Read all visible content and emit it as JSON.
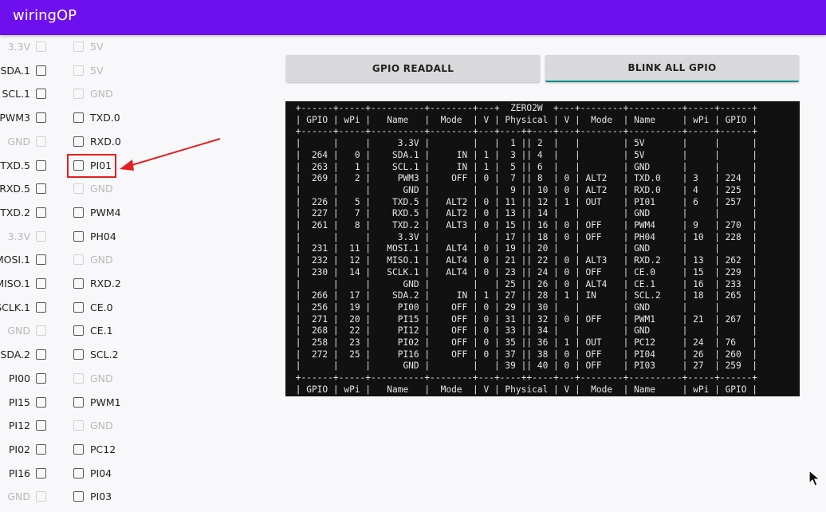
{
  "app": {
    "title": "wiringOP"
  },
  "buttons": {
    "readall": "GPIO READALL",
    "blink": "BLINK ALL GPIO"
  },
  "pins": [
    {
      "left": "3.3V",
      "left_enabled": false,
      "right": "5V",
      "right_enabled": false
    },
    {
      "left": "SDA.1",
      "left_enabled": true,
      "right": "5V",
      "right_enabled": false
    },
    {
      "left": "SCL.1",
      "left_enabled": true,
      "right": "GND",
      "right_enabled": false
    },
    {
      "left": "PWM3",
      "left_enabled": true,
      "right": "TXD.0",
      "right_enabled": true
    },
    {
      "left": "GND",
      "left_enabled": false,
      "right": "RXD.0",
      "right_enabled": true
    },
    {
      "left": "TXD.5",
      "left_enabled": true,
      "right": "PI01",
      "right_enabled": true
    },
    {
      "left": "RXD.5",
      "left_enabled": true,
      "right": "GND",
      "right_enabled": false
    },
    {
      "left": "TXD.2",
      "left_enabled": true,
      "right": "PWM4",
      "right_enabled": true
    },
    {
      "left": "3.3V",
      "left_enabled": false,
      "right": "PH04",
      "right_enabled": true
    },
    {
      "left": "MOSI.1",
      "left_enabled": true,
      "right": "GND",
      "right_enabled": false
    },
    {
      "left": "MISO.1",
      "left_enabled": true,
      "right": "RXD.2",
      "right_enabled": true
    },
    {
      "left": "SCLK.1",
      "left_enabled": true,
      "right": "CE.0",
      "right_enabled": true
    },
    {
      "left": "GND",
      "left_enabled": false,
      "right": "CE.1",
      "right_enabled": true
    },
    {
      "left": "SDA.2",
      "left_enabled": true,
      "right": "SCL.2",
      "right_enabled": true
    },
    {
      "left": "PI00",
      "left_enabled": true,
      "right": "GND",
      "right_enabled": false
    },
    {
      "left": "PI15",
      "left_enabled": true,
      "right": "PWM1",
      "right_enabled": true
    },
    {
      "left": "PI12",
      "left_enabled": true,
      "right": "GND",
      "right_enabled": false
    },
    {
      "left": "PI02",
      "left_enabled": true,
      "right": "PC12",
      "right_enabled": true
    },
    {
      "left": "PI16",
      "left_enabled": true,
      "right": "PI04",
      "right_enabled": true
    },
    {
      "left": "GND",
      "left_enabled": false,
      "right": "PI03",
      "right_enabled": true
    }
  ],
  "terminal": {
    "lines": [
      " +------+-----+----------+--------+---+  ZERO2W  +---+--------+----------+-----+------+",
      " | GPIO | wPi |   Name   |  Mode  | V | Physical | V |  Mode  | Name     | wPi | GPIO |",
      " +------+-----+----------+--------+---+----++----+---+--------+----------+-----+------+",
      " |      |     |     3.3V |        |   |  1 || 2  |   |        | 5V       |     |      |",
      " |  264 |   0 |    SDA.1 |     IN | 1 |  3 || 4  |   |        | 5V       |     |      |",
      " |  263 |   1 |    SCL.1 |     IN | 1 |  5 || 6  |   |        | GND      |     |      |",
      " |  269 |   2 |     PWM3 |    OFF | 0 |  7 || 8  | 0 | ALT2   | TXD.0    | 3   | 224  |",
      " |      |     |      GND |        |   |  9 || 10 | 0 | ALT2   | RXD.0    | 4   | 225  |",
      " |  226 |   5 |    TXD.5 |   ALT2 | 0 | 11 || 12 | 1 | OUT    | PI01     | 6   | 257  |",
      " |  227 |   7 |    RXD.5 |   ALT2 | 0 | 13 || 14 |   |        | GND      |     |      |",
      " |  261 |   8 |    TXD.2 |   ALT3 | 0 | 15 || 16 | 0 | OFF    | PWM4     | 9   | 270  |",
      " |      |     |     3.3V |        |   | 17 || 18 | 0 | OFF    | PH04     | 10  | 228  |",
      " |  231 |  11 |   MOSI.1 |   ALT4 | 0 | 19 || 20 |   |        | GND      |     |      |",
      " |  232 |  12 |   MISO.1 |   ALT4 | 0 | 21 || 22 | 0 | ALT3   | RXD.2    | 13  | 262  |",
      " |  230 |  14 |   SCLK.1 |   ALT4 | 0 | 23 || 24 | 0 | OFF    | CE.0     | 15  | 229  |",
      " |      |     |      GND |        |   | 25 || 26 | 0 | ALT4   | CE.1     | 16  | 233  |",
      " |  266 |  17 |    SDA.2 |     IN | 1 | 27 || 28 | 1 | IN     | SCL.2    | 18  | 265  |",
      " |  256 |  19 |     PI00 |    OFF | 0 | 29 || 30 |   |        | GND      |     |      |",
      " |  271 |  20 |     PI15 |    OFF | 0 | 31 || 32 | 0 | OFF    | PWM1     | 21  | 267  |",
      " |  268 |  22 |     PI12 |    OFF | 0 | 33 || 34 |   |        | GND      |     |      |",
      " |  258 |  23 |     PI02 |    OFF | 0 | 35 || 36 | 1 | OUT    | PC12     | 24  | 76   |",
      " |  272 |  25 |     PI16 |    OFF | 0 | 37 || 38 | 0 | OFF    | PI04     | 26  | 260  |",
      " |      |     |      GND |        |   | 39 || 40 | 0 | OFF    | PI03     | 27  | 259  |",
      " +------+-----+----------+--------+---+----++----+---+--------+----------+-----+------+",
      " | GPIO | wPi |   Name   |  Mode  | V | Physical | V |  Mode  | Name     | wPi | GPIO |"
    ]
  },
  "colors": {
    "app_bar": "#6e10ee",
    "highlight": "#e32020",
    "button_accent": "#0a9088",
    "terminal_bg": "#111111"
  },
  "icons": {
    "annotation": "red-arrow-icon",
    "cursor": "mouse-pointer-icon"
  }
}
